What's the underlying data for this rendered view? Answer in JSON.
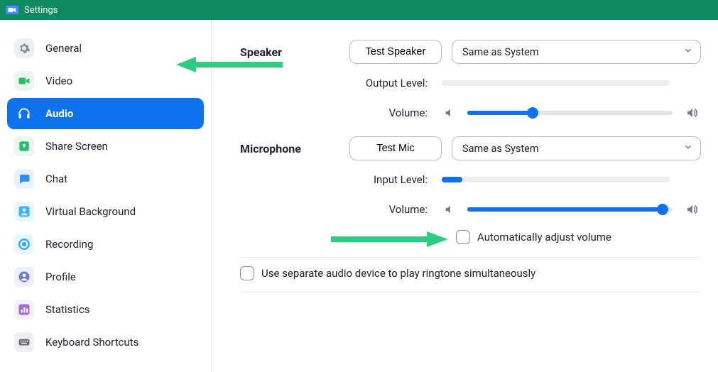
{
  "window": {
    "title": "Settings"
  },
  "sidebar": {
    "items": [
      {
        "label": "General",
        "icon": "gear",
        "bg": "#eceff4",
        "fg": "#8d8d98",
        "active": false
      },
      {
        "label": "Video",
        "icon": "video",
        "bg": "#e9f7ef",
        "fg": "#2bbd6b",
        "active": false
      },
      {
        "label": "Audio",
        "icon": "headphone",
        "bg": "transparent",
        "fg": "#ffffff",
        "active": true
      },
      {
        "label": "Share Screen",
        "icon": "share",
        "bg": "#e9f7ef",
        "fg": "#2bbd6b",
        "active": false
      },
      {
        "label": "Chat",
        "icon": "chat",
        "bg": "#e8f2ff",
        "fg": "#2e90fa",
        "active": false
      },
      {
        "label": "Virtual Background",
        "icon": "person-bg",
        "bg": "#e8f6ff",
        "fg": "#37b6ff",
        "active": false
      },
      {
        "label": "Recording",
        "icon": "record",
        "bg": "#e8f6ff",
        "fg": "#1fa8ff",
        "active": false
      },
      {
        "label": "Profile",
        "icon": "avatar",
        "bg": "#eef0ff",
        "fg": "#6b7bd6",
        "active": false
      },
      {
        "label": "Statistics",
        "icon": "stats",
        "bg": "#f4eeff",
        "fg": "#a06bd6",
        "active": false
      },
      {
        "label": "Keyboard Shortcuts",
        "icon": "keyboard",
        "bg": "#efeff3",
        "fg": "#6e6e80",
        "active": false
      }
    ]
  },
  "audio": {
    "speaker": {
      "section_label": "Speaker",
      "test_label": "Test Speaker",
      "device": "Same as System",
      "output_level_label": "Output Level:",
      "output_level_pct": 0,
      "volume_label": "Volume:",
      "volume_pct": 32
    },
    "microphone": {
      "section_label": "Microphone",
      "test_label": "Test Mic",
      "device": "Same as System",
      "input_level_label": "Input Level:",
      "input_level_pct": 9,
      "volume_label": "Volume:",
      "volume_pct": 95,
      "auto_adjust_label": "Automatically adjust volume",
      "auto_adjust_checked": false
    },
    "separate_device_label": "Use separate audio device to play ringtone simultaneously",
    "separate_device_checked": false
  }
}
